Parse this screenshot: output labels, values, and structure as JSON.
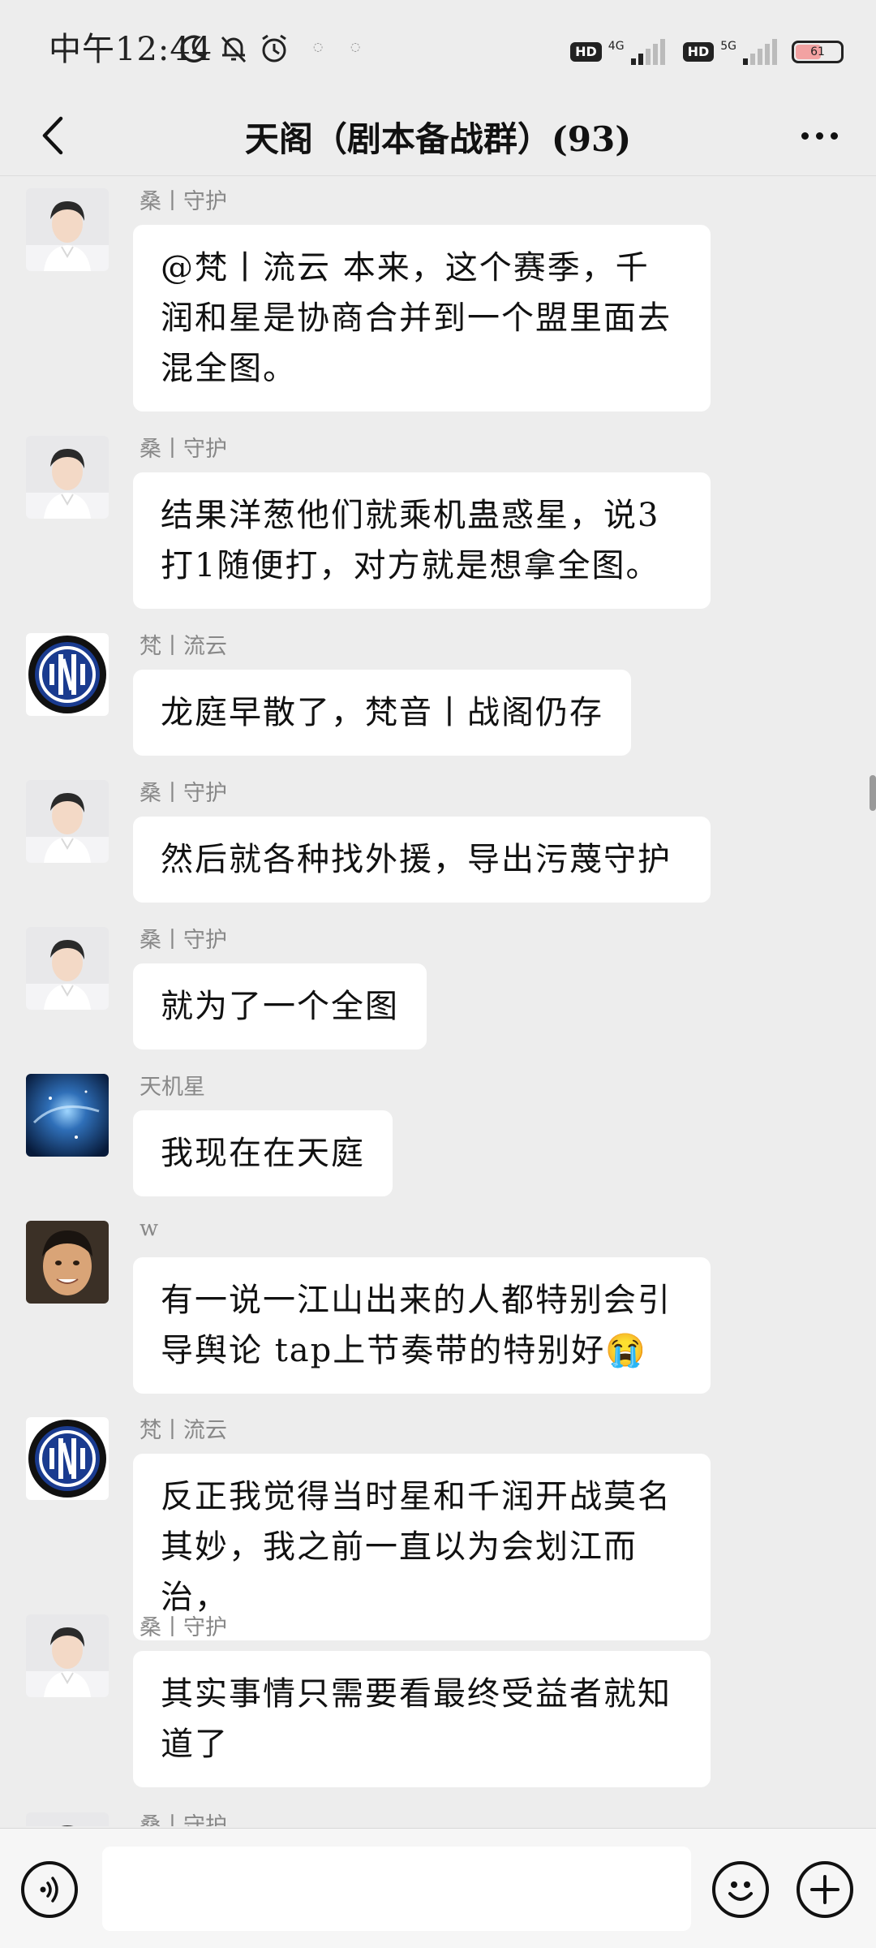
{
  "status_bar": {
    "time": "中午12:44",
    "network_1": "4G",
    "network_2": "5G",
    "hd_label": "HD",
    "battery_text": "61",
    "battery_level": 0.61,
    "icons": [
      "moon-icon",
      "bell-off-icon",
      "alarm-icon"
    ]
  },
  "header": {
    "title": "天阁（剧本备战群）(93)"
  },
  "messages": [
    {
      "sender": "桑丨守护",
      "text": "@梵丨流云  本来，这个赛季，千润和星是协商合并到一个盟里面去混全图。",
      "avatar": "man-avatar"
    },
    {
      "sender": "桑丨守护",
      "text": "结果洋葱他们就乘机蛊惑星，说3打1随便打，对方就是想拿全图。",
      "avatar": "man-avatar"
    },
    {
      "sender": "梵丨流云",
      "text": "龙庭早散了，梵音丨战阁仍存",
      "avatar": "inter-logo-avatar"
    },
    {
      "sender": "桑丨守护",
      "text": "然后就各种找外援，导出污蔑守护",
      "avatar": "man-avatar"
    },
    {
      "sender": "桑丨守护",
      "text": "就为了一个全图",
      "avatar": "man-avatar"
    },
    {
      "sender": "天机星",
      "text": "我现在在天庭",
      "avatar": "galaxy-avatar"
    },
    {
      "sender": "w",
      "text": "有一说一江山出来的人都特别会引导舆论 tap上节奏带的特别好😭",
      "avatar": "boy-avatar"
    },
    {
      "sender": "梵丨流云",
      "text": "反正我觉得当时星和千润开战莫名其妙，我之前一直以为会划江而治，",
      "avatar": "inter-logo-avatar"
    },
    {
      "sender": "桑丨守护",
      "text": "其实事情只需要看最终受益者就知道了",
      "avatar": "man-avatar"
    },
    {
      "sender": "桑丨守护",
      "text": "",
      "avatar": "man-avatar"
    }
  ],
  "input_bar": {
    "value": "",
    "placeholder": "",
    "icons": [
      "voice-icon",
      "emoji-icon",
      "plus-icon"
    ]
  },
  "colors": {
    "background": "#ededed",
    "bubble": "#ffffff",
    "inter_blue": "#1a3b8f"
  }
}
